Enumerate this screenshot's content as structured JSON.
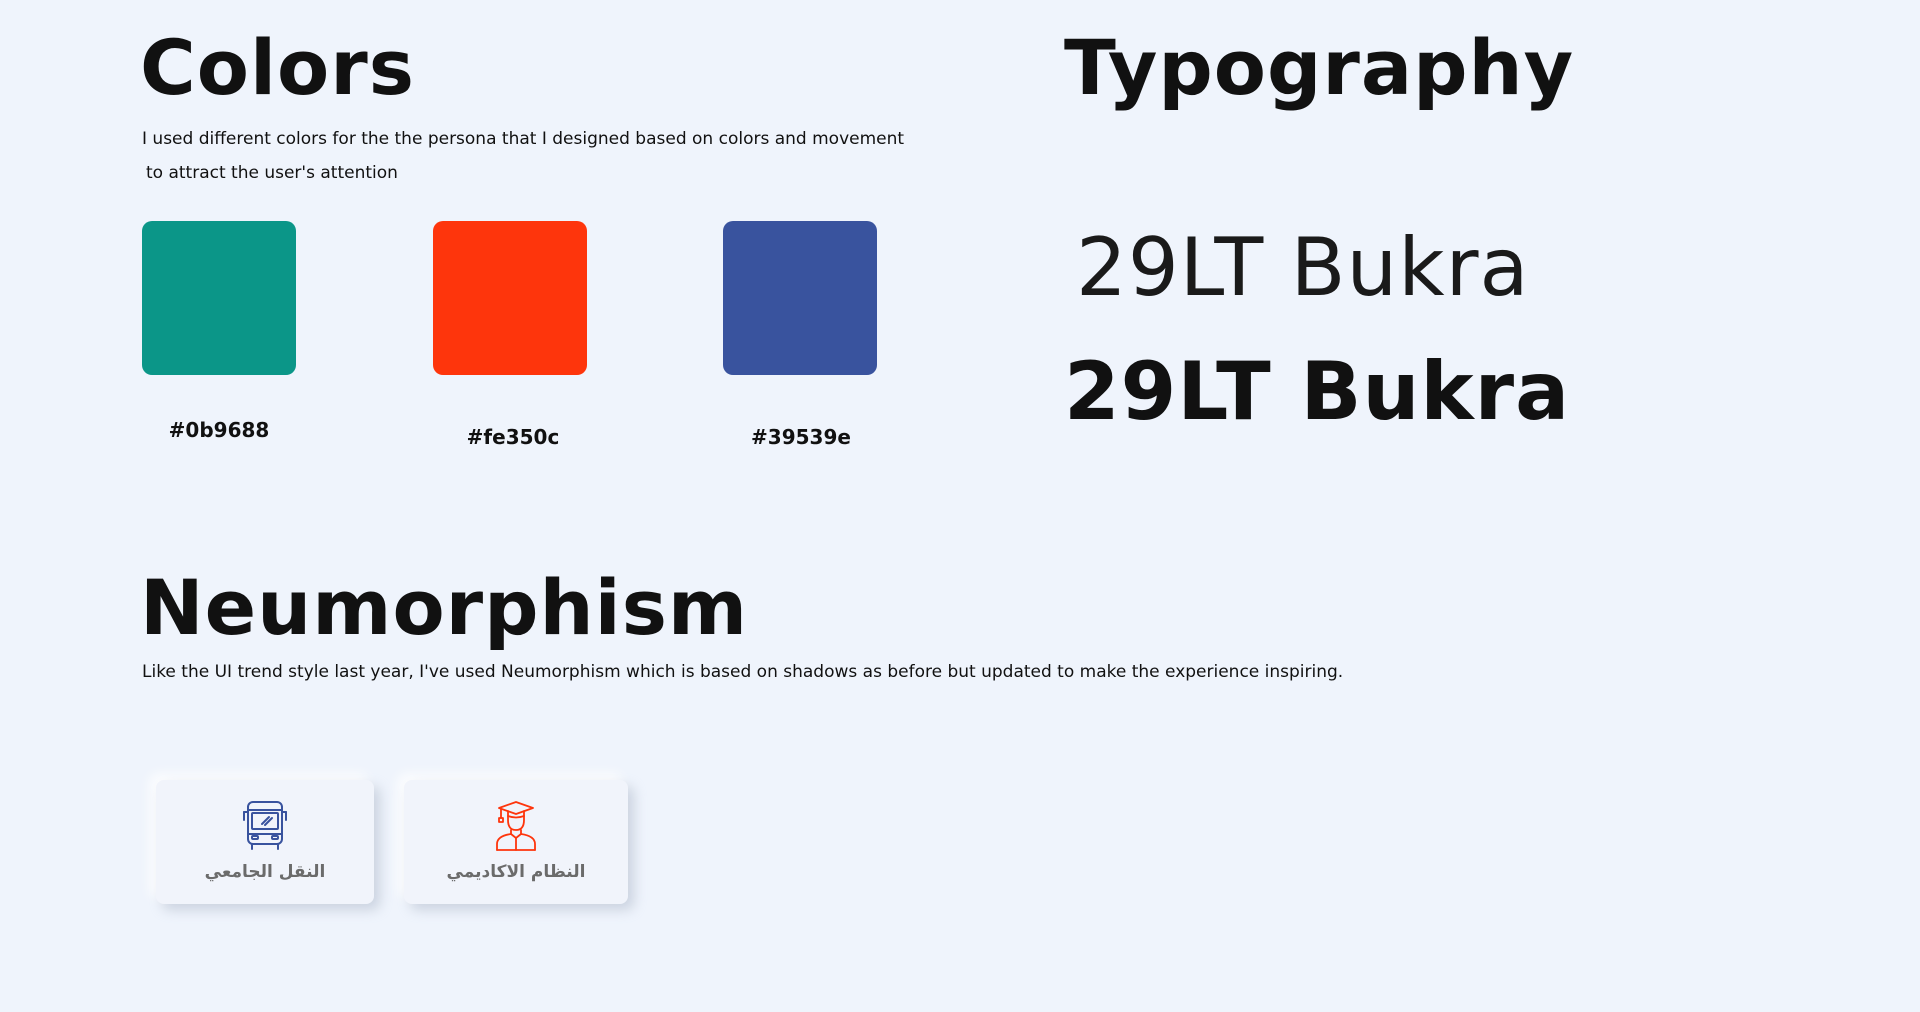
{
  "colors": {
    "title": "Colors",
    "description_line1": "I used different colors for the the persona  that I designed based on colors and movement",
    "description_line2": "to attract the user's attention",
    "swatches": [
      {
        "hex": "#0b9688",
        "label": "#0b9688"
      },
      {
        "hex": "#fe350c",
        "label": "#fe350c"
      },
      {
        "hex": "#39539e",
        "label": "#39539e"
      }
    ]
  },
  "typography": {
    "title": "Typography",
    "sample_light": "29LT Bukra",
    "sample_bold": "29LT Bukra"
  },
  "neumorphism": {
    "title": "Neumorphism",
    "description": "Like the UI  trend style last year, I've used Neumorphism which is based on shadows as before but updated to make the experience inspiring.",
    "cards": [
      {
        "label": "النقل الجامعي",
        "icon": "bus-icon",
        "icon_color": "#39539e"
      },
      {
        "label": "النظام الاكاديمي",
        "icon": "graduate-icon",
        "icon_color": "#fe350c"
      }
    ]
  }
}
